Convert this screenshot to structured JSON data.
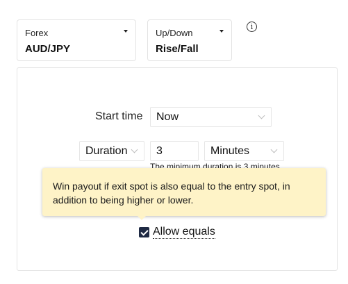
{
  "market_selector": {
    "label": "Forex",
    "value": "AUD/JPY",
    "icon": "caret-down-icon"
  },
  "trade_type_selector": {
    "label": "Up/Down",
    "value": "Rise/Fall",
    "icon": "caret-down-icon"
  },
  "info": {
    "icon": "info-circle-icon",
    "glyph": "i"
  },
  "form": {
    "start_time": {
      "label": "Start time",
      "value": "Now"
    },
    "duration": {
      "type_value": "Duration",
      "amount": "3",
      "unit_value": "Minutes",
      "note": "The minimum duration is 3 minutes"
    },
    "allow_equals": {
      "label": "Allow equals",
      "checked": true
    }
  },
  "tooltip": {
    "text": "Win payout if exit spot is also equal to the entry spot, in addition to being higher or lower."
  },
  "colors": {
    "checkbox_fill": "#1f2a44",
    "tooltip_bg": "#fef3c7",
    "border": "#e4e4e4"
  }
}
